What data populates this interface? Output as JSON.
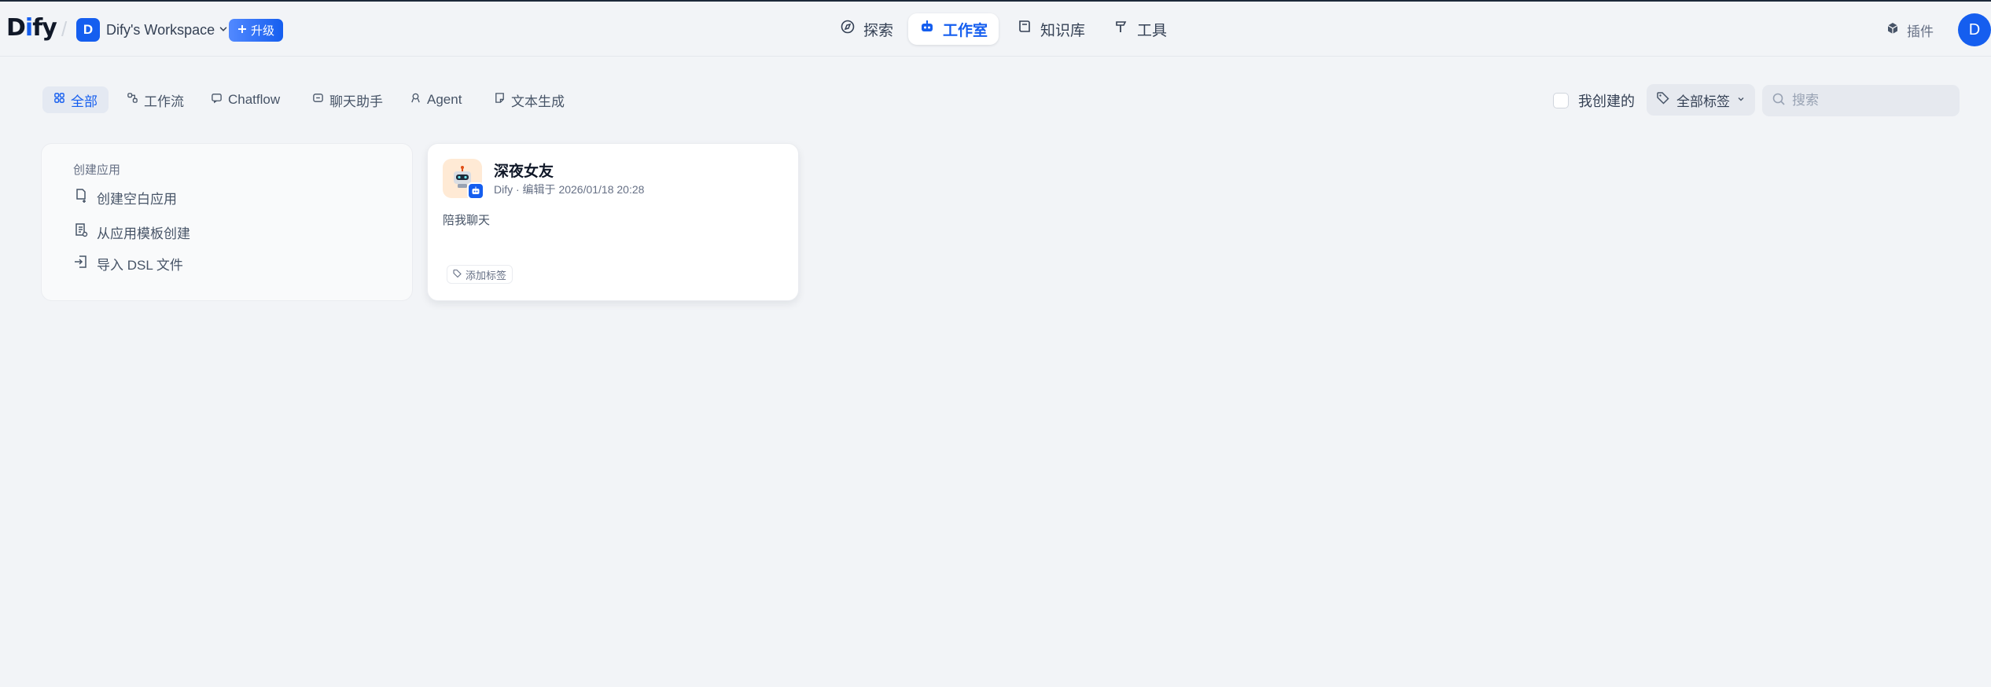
{
  "header": {
    "logo": {
      "part1": "D",
      "part2": "i",
      "part3": "fy"
    },
    "workspace": {
      "avatar": "D",
      "name": "Dify's Workspace",
      "upgrade_label": "升级"
    },
    "nav": [
      {
        "label": "探索",
        "icon": "compass-icon",
        "active": false
      },
      {
        "label": "工作室",
        "icon": "robot-icon",
        "active": true
      },
      {
        "label": "知识库",
        "icon": "book-icon",
        "active": false
      },
      {
        "label": "工具",
        "icon": "hammer-icon",
        "active": false
      }
    ],
    "plugins_label": "插件",
    "user_avatar": "D"
  },
  "filters": {
    "tabs": [
      {
        "label": "全部",
        "icon": "grid-icon",
        "active": true
      },
      {
        "label": "工作流",
        "icon": "workflow-icon",
        "active": false
      },
      {
        "label": "Chatflow",
        "icon": "chat-bubble-icon",
        "active": false
      },
      {
        "label": "聊天助手",
        "icon": "message-icon",
        "active": false
      },
      {
        "label": "Agent",
        "icon": "agent-icon",
        "active": false
      },
      {
        "label": "文本生成",
        "icon": "document-icon",
        "active": false
      }
    ],
    "mine_label": "我创建的",
    "tag_filter_label": "全部标签",
    "search_placeholder": "搜索"
  },
  "create_card": {
    "title": "创建应用",
    "items": [
      {
        "label": "创建空白应用",
        "icon": "file-plus-icon"
      },
      {
        "label": "从应用模板创建",
        "icon": "template-icon"
      },
      {
        "label": "导入 DSL 文件",
        "icon": "import-icon"
      }
    ]
  },
  "apps": [
    {
      "name": "深夜女友",
      "meta": "Dify · 编辑于 2026/01/18 20:28",
      "description": "陪我聊天",
      "add_tag_label": "添加标签"
    }
  ],
  "colors": {
    "accent": "#155eef",
    "background": "#f2f4f7",
    "card": "#ffffff",
    "icon_bg": "#ffead5"
  }
}
